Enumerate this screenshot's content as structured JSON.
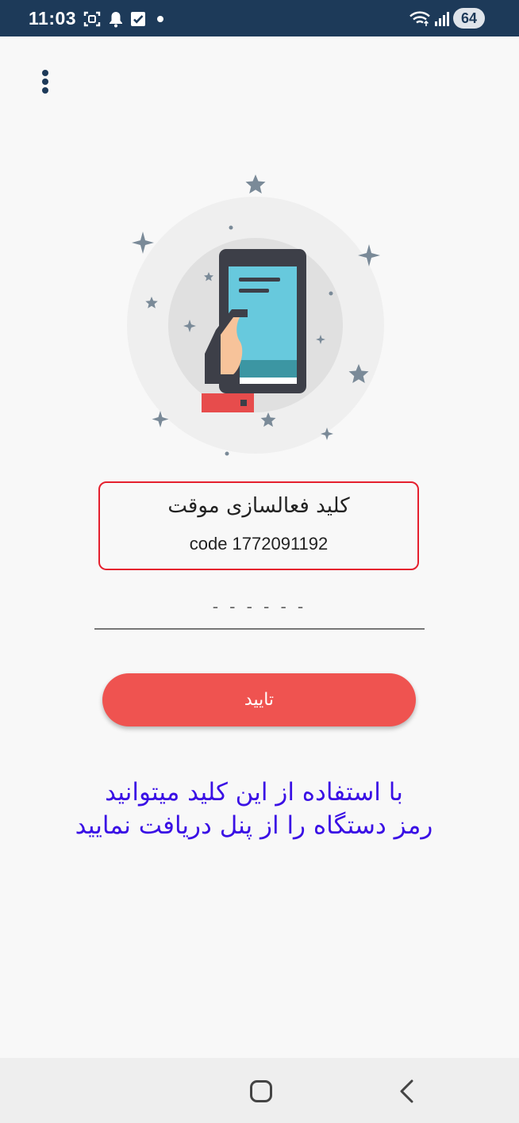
{
  "status_bar": {
    "time": "11:03",
    "battery": "64",
    "icons": [
      "screenshot-icon",
      "bell-icon",
      "checkbox-icon",
      "dot-icon",
      "wifi-icon",
      "signal-icon",
      "battery-icon"
    ]
  },
  "menu": {
    "icon": "more-vert-icon"
  },
  "activation": {
    "title": "کلید فعالسازی موقت",
    "code": "code 1772091192"
  },
  "code_input": {
    "value": "",
    "placeholder": "- - - - - -"
  },
  "confirm_button": {
    "label": "تایید"
  },
  "info_text": "با استفاده از این کلید میتوانید\nرمز دستگاه را از پنل دریافت نمایید",
  "nav_bar": {
    "icons": [
      "home-icon",
      "back-icon"
    ]
  },
  "colors": {
    "status_bar": "#1d3a59",
    "accent_button": "#ef5350",
    "box_border": "#e5202e",
    "info_text": "#3a10e5"
  }
}
